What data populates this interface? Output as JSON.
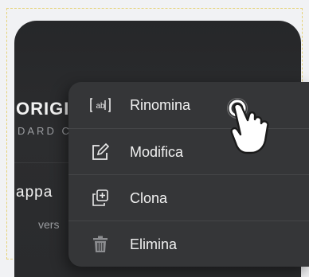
{
  "background_card": {
    "title_fragment": "ORIGI",
    "subtitle_fragment": "DARD C",
    "app_fragment": "appa",
    "version_fragment": "vers"
  },
  "context_menu": {
    "items": [
      {
        "label": "Rinomina",
        "icon": "rename-icon"
      },
      {
        "label": "Modifica",
        "icon": "edit-icon"
      },
      {
        "label": "Clona",
        "icon": "clone-icon"
      },
      {
        "label": "Elimina",
        "icon": "trash-icon"
      }
    ]
  },
  "colors": {
    "card": "#2a2b2d",
    "menu": "#353638",
    "text": "#f1f1f1"
  }
}
